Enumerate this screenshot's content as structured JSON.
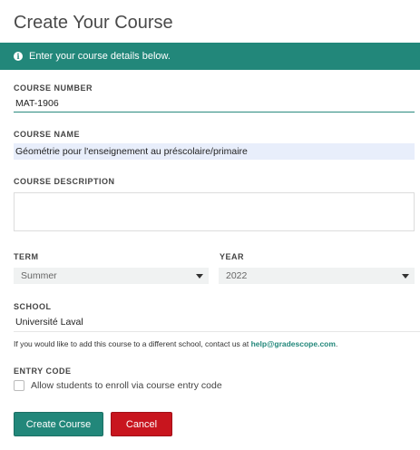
{
  "page": {
    "title": "Create Your Course"
  },
  "banner": {
    "icon": "info-icon",
    "text": "Enter your course details below."
  },
  "form": {
    "course_number": {
      "label": "COURSE NUMBER",
      "value": "MAT-1906"
    },
    "course_name": {
      "label": "COURSE NAME",
      "value": "Géométrie pour l'enseignement au préscolaire/primaire"
    },
    "course_description": {
      "label": "COURSE DESCRIPTION",
      "value": ""
    },
    "term": {
      "label": "TERM",
      "selected": "Summer"
    },
    "year": {
      "label": "YEAR",
      "selected": "2022"
    },
    "school": {
      "label": "SCHOOL",
      "value": "Université Laval"
    },
    "help": {
      "text": "If you would like to add this course to a different school, contact us at ",
      "email": "help@gradescope.com",
      "suffix": "."
    },
    "entry_code": {
      "label": "ENTRY CODE",
      "checkbox_label": "Allow students to enroll via course entry code",
      "checked": false
    }
  },
  "actions": {
    "create_label": "Create Course",
    "cancel_label": "Cancel"
  },
  "colors": {
    "accent": "#22877a",
    "danger": "#c8151e",
    "autofill": "#e8eefb"
  }
}
